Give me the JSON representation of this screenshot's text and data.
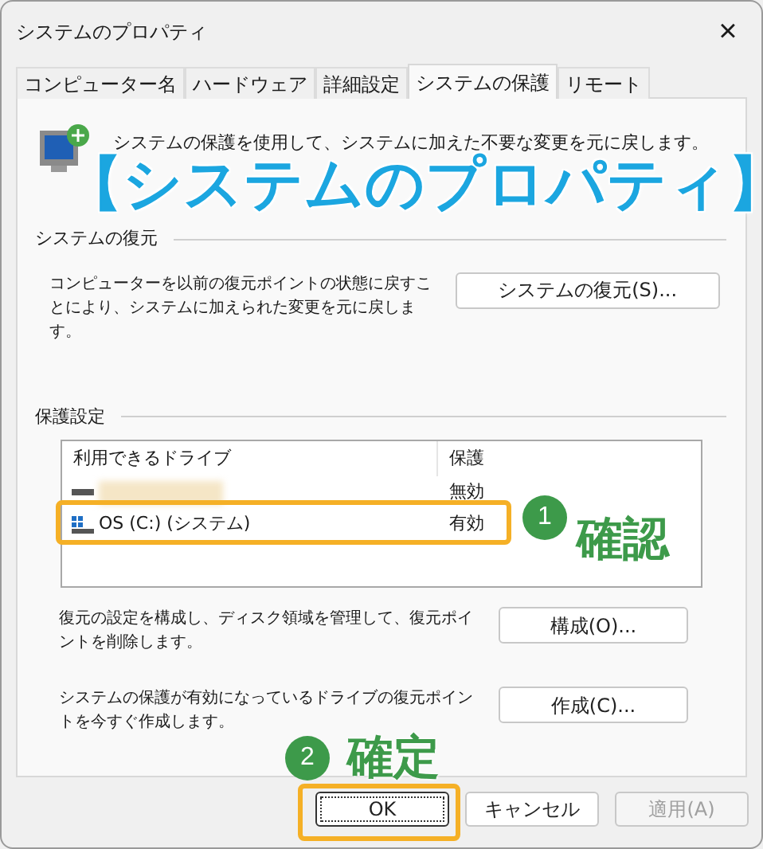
{
  "window": {
    "title": "システムのプロパティ",
    "close": "×"
  },
  "tabs": [
    {
      "label": "コンピューター名",
      "selected": false
    },
    {
      "label": "ハードウェア",
      "selected": false
    },
    {
      "label": "詳細設定",
      "selected": false
    },
    {
      "label": "システムの保護",
      "selected": true
    },
    {
      "label": "リモート",
      "selected": false
    }
  ],
  "intro": "システムの保護を使用して、システムに加えた不要な変更を元に戻します。",
  "restore": {
    "heading": "システムの復元",
    "text": "コンピューターを以前の復元ポイントの状態に戻すことにより、システムに加えられた変更を元に戻します。",
    "button": "システムの復元(S)..."
  },
  "protection": {
    "heading": "保護設定",
    "columns": [
      "利用できるドライブ",
      "保護"
    ],
    "drives": [
      {
        "kind": "redacted",
        "status": "無効"
      },
      {
        "kind": "system",
        "name": "OS (C:) (システム)",
        "status": "有効"
      }
    ],
    "actions": [
      {
        "text": "復元の設定を構成し、ディスク領域を管理して、復元ポイントを削除します。",
        "button": "構成(O)..."
      },
      {
        "text": "システムの保護が有効になっているドライブの復元ポイントを今すぐ作成します。",
        "button": "作成(C)..."
      }
    ]
  },
  "buttons": [
    {
      "label": "OK",
      "disabled": false,
      "default": true
    },
    {
      "label": "キャンセル",
      "disabled": false,
      "default": false
    },
    {
      "label": "適用(A)",
      "disabled": true,
      "default": false
    }
  ],
  "annotations": {
    "title": "【システムのプロパティ】",
    "steps": [
      {
        "number": "1",
        "label": "確認"
      },
      {
        "number": "2",
        "label": "確定"
      }
    ]
  }
}
